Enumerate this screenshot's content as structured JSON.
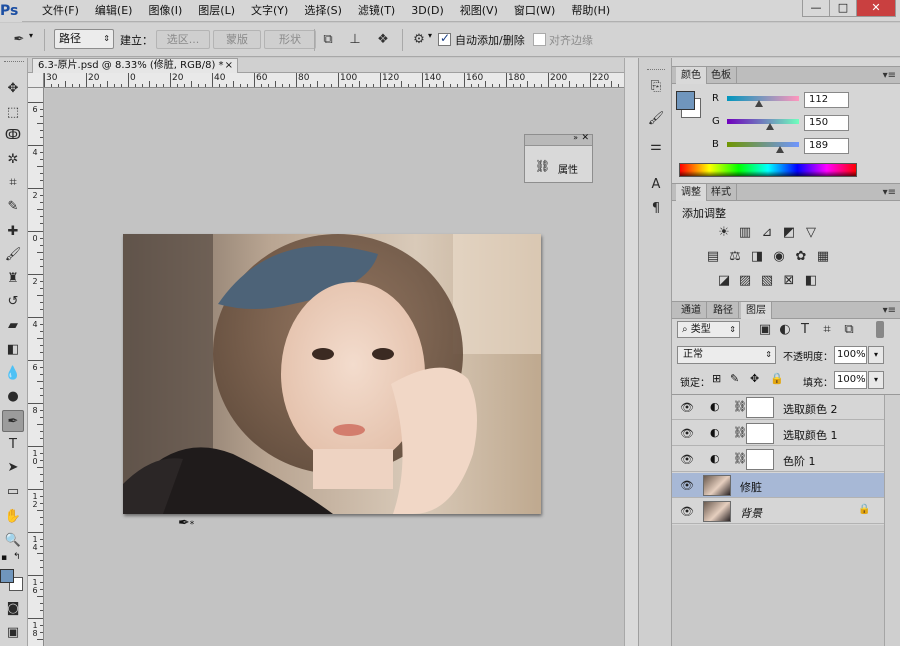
{
  "app": {
    "logo": "Ps"
  },
  "menu": [
    "文件(F)",
    "编辑(E)",
    "图像(I)",
    "图层(L)",
    "文字(Y)",
    "选择(S)",
    "滤镜(T)",
    "3D(D)",
    "视图(V)",
    "窗口(W)",
    "帮助(H)"
  ],
  "window_controls": {
    "minimize": "—",
    "maximize": "□",
    "close": "✕"
  },
  "options": {
    "mode_select": "路径",
    "build_label": "建立：",
    "btn_selection": "选区...",
    "btn_mask": "蒙版",
    "btn_shape": "形状",
    "auto_add_delete": "自动添加/删除",
    "auto_add_delete_checked": true,
    "align_edges": "对齐边缘",
    "align_edges_checked": false
  },
  "document": {
    "tab_title": "6.3-原片.psd @ 8.33% (修脏, RGB/8) *",
    "close": "×"
  },
  "ruler_top": [
    "30",
    "20",
    "0",
    "20",
    "40",
    "60",
    "80",
    "100",
    "120",
    "140",
    "160",
    "180",
    "200",
    "220"
  ],
  "ruler_left": [
    "6",
    "4",
    "2",
    "0",
    "2",
    "4",
    "6",
    "8",
    "10",
    "12",
    "14",
    "16",
    "18"
  ],
  "properties_panel": {
    "label": "属性"
  },
  "color_panel": {
    "tabs": [
      "颜色",
      "色板"
    ],
    "channels": [
      {
        "name": "R",
        "value": "112"
      },
      {
        "name": "G",
        "value": "150"
      },
      {
        "name": "B",
        "value": "189"
      }
    ],
    "swatch": "#7096bd"
  },
  "adjustments_panel": {
    "tabs": [
      "调整",
      "样式"
    ],
    "title": "添加调整"
  },
  "layers_panel": {
    "tabs": [
      "通道",
      "路径",
      "图层"
    ],
    "filter_kind": "类型",
    "blend_mode": "正常",
    "opacity_label": "不透明度：",
    "opacity": "100%",
    "lock_label": "锁定：",
    "fill_label": "填充：",
    "fill": "100%",
    "layers": [
      {
        "name": "选取颜色 2"
      },
      {
        "name": "选取颜色 1"
      },
      {
        "name": "色阶 1"
      },
      {
        "name": "修脏"
      },
      {
        "name": "背景"
      }
    ]
  }
}
